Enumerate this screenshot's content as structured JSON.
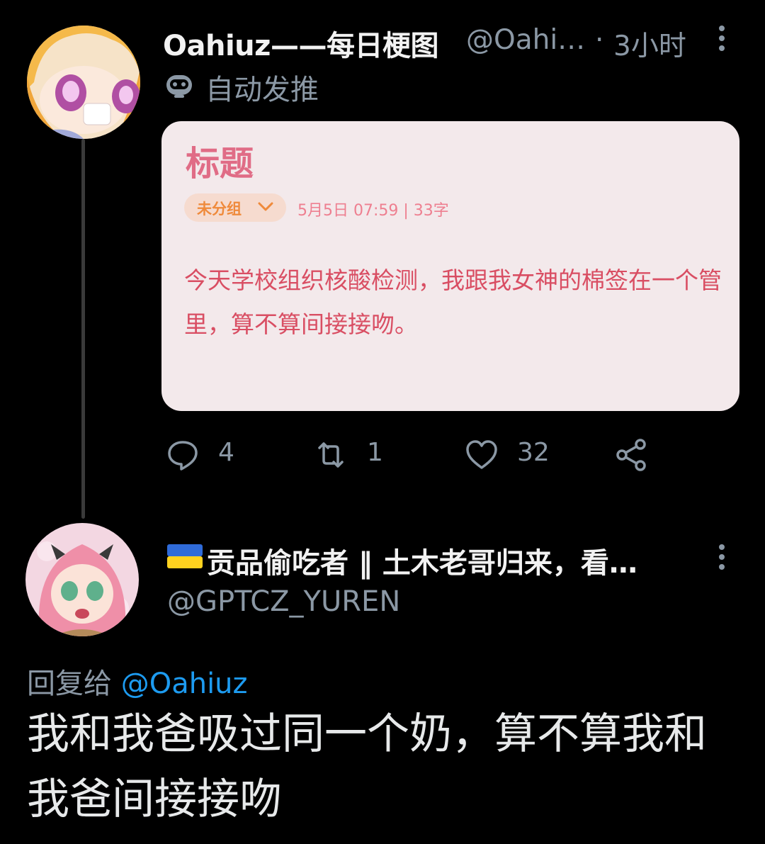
{
  "tweet1": {
    "display_name": "Oahiuz——每日梗图",
    "handle": "@Oahi…",
    "separator": "·",
    "time": "3小时",
    "auto_label": "自动发推",
    "image_note": {
      "title": "标题",
      "group_label": "未分组",
      "meta": "5月5日 07:59 | 33字",
      "body": "今天学校组织核酸检测，我跟我女神的棉签在一个管里，算不算间接接吻。"
    },
    "actions": {
      "reply_count": "4",
      "retweet_count": "1",
      "like_count": "32"
    }
  },
  "tweet2": {
    "display_name": "贡品偷吃者 ‖ 土木老哥归来，看…",
    "handle": "@GPTCZ_YUREN",
    "reply_prefix": "回复给",
    "reply_to": "@Oahiuz",
    "text": "我和我爸吸过同一个奶，算不算我和我爸间接接吻"
  },
  "colors": {
    "background": "#000000",
    "secondary_text": "#8b98a5",
    "link": "#1d9bf0",
    "card_background": "#f3e9eb",
    "note_title": "#e06c86",
    "note_body": "#d94e63"
  },
  "icons": [
    "more-vertical-icon",
    "robot-icon",
    "chevron-down-icon",
    "reply-icon",
    "retweet-icon",
    "like-icon",
    "share-icon",
    "ukraine-flag-icon"
  ]
}
